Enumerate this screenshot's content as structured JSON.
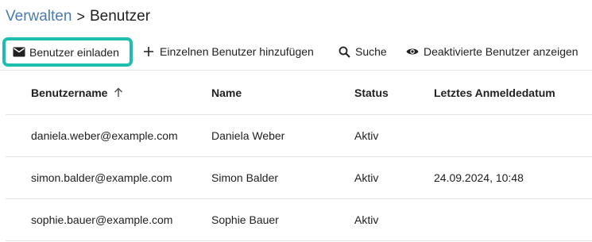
{
  "breadcrumb": {
    "parent": "Verwalten",
    "separator": ">",
    "current": "Benutzer"
  },
  "toolbar": {
    "invite_label": "Benutzer einladen",
    "add_label": "Einzelnen Benutzer hinzufügen",
    "search_label": "Suche",
    "deactivated_label": "Deaktivierte Benutzer anzeigen",
    "highlight_color": "#1fbfb0"
  },
  "table": {
    "columns": {
      "username": "Benutzername",
      "name": "Name",
      "status": "Status",
      "last_login": "Letztes Anmeldedatum"
    },
    "sort_column": "username",
    "sort_direction": "ascending",
    "rows": [
      {
        "username": "daniela.weber@example.com",
        "name": "Daniela Weber",
        "status": "Aktiv",
        "last_login": ""
      },
      {
        "username": "simon.balder@example.com",
        "name": "Simon Balder",
        "status": "Aktiv",
        "last_login": "24.09.2024, 10:48"
      },
      {
        "username": "sophie.bauer@example.com",
        "name": "Sophie Bauer",
        "status": "Aktiv",
        "last_login": ""
      }
    ]
  },
  "colors": {
    "link": "#4a7bb3",
    "text": "#212121",
    "divider": "#e3e3e3"
  }
}
